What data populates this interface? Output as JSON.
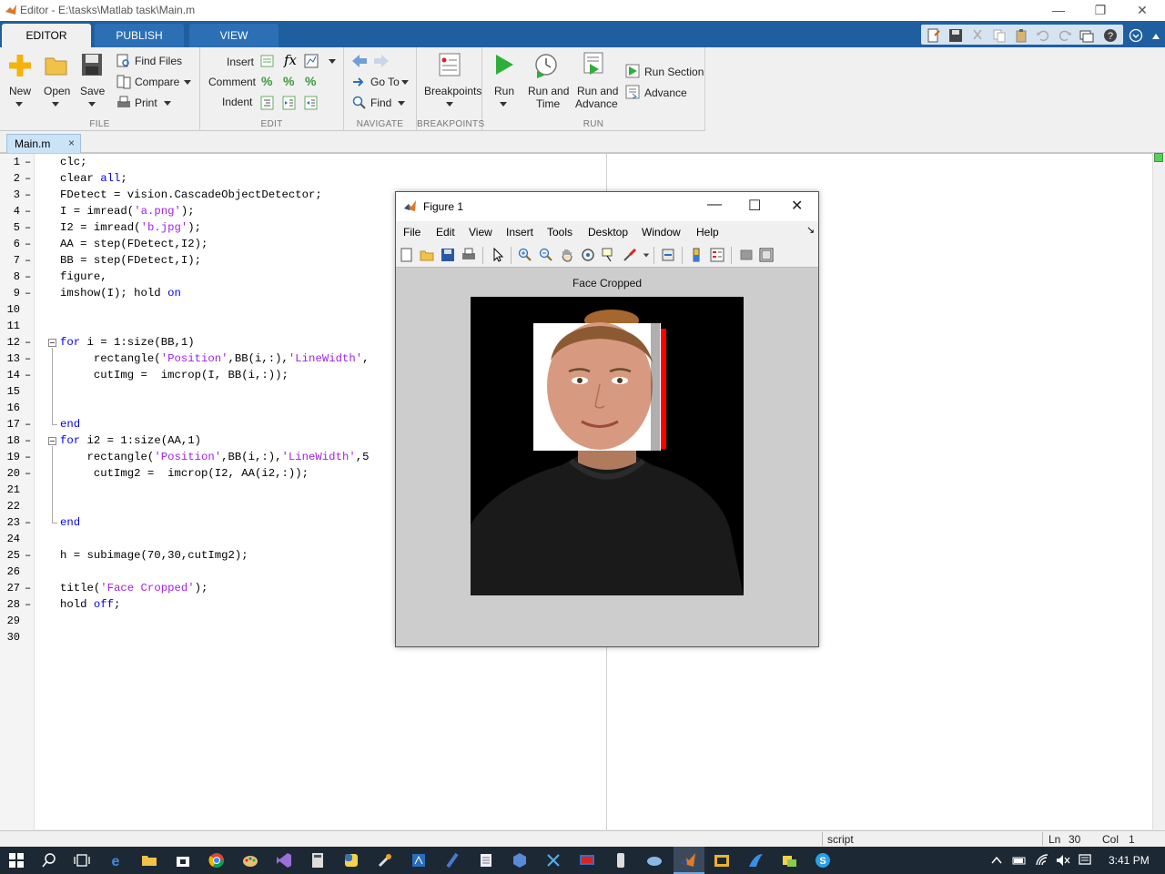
{
  "window": {
    "title": "Editor - E:\\tasks\\Matlab task\\Main.m",
    "minimize_glyph": "—",
    "restore_glyph": "❐",
    "close_glyph": "✕"
  },
  "ribbon_tabs": [
    {
      "label": "EDITOR",
      "active": true
    },
    {
      "label": "PUBLISH",
      "active": false
    },
    {
      "label": "VIEW",
      "active": false
    }
  ],
  "ribbon": {
    "file": {
      "section_label": "FILE",
      "new_label": "New",
      "open_label": "Open",
      "save_label": "Save",
      "find_files_label": "Find Files",
      "compare_label": "Compare",
      "print_label": "Print"
    },
    "edit": {
      "section_label": "EDIT",
      "insert_label": "Insert",
      "comment_label": "Comment",
      "indent_label": "Indent"
    },
    "navigate": {
      "section_label": "NAVIGATE",
      "goto_label": "Go To",
      "find_label": "Find"
    },
    "breakpoints": {
      "section_label": "BREAKPOINTS",
      "breakpoints_label": "Breakpoints"
    },
    "run": {
      "section_label": "RUN",
      "run_label": "Run",
      "run_time_line1": "Run and",
      "run_time_line2": "Time",
      "run_advance_line1": "Run and",
      "run_advance_line2": "Advance",
      "run_section_label": "Run Section",
      "advance_label": "Advance"
    }
  },
  "doc_tab": {
    "label": "Main.m",
    "close_glyph": "×"
  },
  "editor": {
    "lines": [
      {
        "n": "1",
        "dash": true,
        "parts": [
          [
            "t",
            "clc;"
          ]
        ]
      },
      {
        "n": "2",
        "dash": true,
        "parts": [
          [
            "t",
            "clear "
          ],
          [
            "k",
            "all"
          ],
          [
            "t",
            ";"
          ]
        ]
      },
      {
        "n": "3",
        "dash": true,
        "parts": [
          [
            "t",
            "FDetect = vision.CascadeObjectDetector;"
          ]
        ]
      },
      {
        "n": "4",
        "dash": true,
        "parts": [
          [
            "t",
            "I = imread("
          ],
          [
            "s",
            "'a.png'"
          ],
          [
            "t",
            ");"
          ]
        ]
      },
      {
        "n": "5",
        "dash": true,
        "parts": [
          [
            "t",
            "I2 = imread("
          ],
          [
            "s",
            "'b.jpg'"
          ],
          [
            "t",
            ");"
          ]
        ]
      },
      {
        "n": "6",
        "dash": true,
        "parts": [
          [
            "t",
            "AA = step(FDetect,I2);"
          ]
        ]
      },
      {
        "n": "7",
        "dash": true,
        "parts": [
          [
            "t",
            "BB = step(FDetect,I);"
          ]
        ]
      },
      {
        "n": "8",
        "dash": true,
        "parts": [
          [
            "t",
            "figure,"
          ]
        ]
      },
      {
        "n": "9",
        "dash": true,
        "parts": [
          [
            "t",
            "imshow(I); hold "
          ],
          [
            "k",
            "on"
          ]
        ]
      },
      {
        "n": "10",
        "dash": false,
        "parts": []
      },
      {
        "n": "11",
        "dash": false,
        "parts": []
      },
      {
        "n": "12",
        "dash": true,
        "parts": [
          [
            "k",
            "for"
          ],
          [
            "t",
            " i = 1:size(BB,1)"
          ]
        ]
      },
      {
        "n": "13",
        "dash": true,
        "parts": [
          [
            "t",
            "     rectangle("
          ],
          [
            "s",
            "'Position'"
          ],
          [
            "t",
            ",BB(i,:),"
          ],
          [
            "s",
            "'LineWidth'"
          ],
          [
            "t",
            ","
          ]
        ]
      },
      {
        "n": "14",
        "dash": true,
        "parts": [
          [
            "t",
            "     cutImg =  imcrop(I, BB(i,:));"
          ]
        ]
      },
      {
        "n": "15",
        "dash": false,
        "parts": []
      },
      {
        "n": "16",
        "dash": false,
        "parts": []
      },
      {
        "n": "17",
        "dash": true,
        "parts": [
          [
            "k",
            "end"
          ]
        ]
      },
      {
        "n": "18",
        "dash": true,
        "parts": [
          [
            "k",
            "for"
          ],
          [
            "t",
            " i2 = 1:size(AA,1)"
          ]
        ]
      },
      {
        "n": "19",
        "dash": true,
        "parts": [
          [
            "t",
            "    rectangle("
          ],
          [
            "s",
            "'Position'"
          ],
          [
            "t",
            ",BB(i,:),"
          ],
          [
            "s",
            "'LineWidth'"
          ],
          [
            "t",
            ",5"
          ]
        ]
      },
      {
        "n": "20",
        "dash": true,
        "parts": [
          [
            "t",
            "     cutImg2 =  imcrop(I2, AA(i2,:));"
          ]
        ]
      },
      {
        "n": "21",
        "dash": false,
        "parts": []
      },
      {
        "n": "22",
        "dash": false,
        "parts": []
      },
      {
        "n": "23",
        "dash": true,
        "parts": [
          [
            "k",
            "end"
          ]
        ]
      },
      {
        "n": "24",
        "dash": false,
        "parts": []
      },
      {
        "n": "25",
        "dash": true,
        "parts": [
          [
            "t",
            "h = subimage(70,30,cutImg2);"
          ]
        ]
      },
      {
        "n": "26",
        "dash": false,
        "parts": []
      },
      {
        "n": "27",
        "dash": true,
        "parts": [
          [
            "t",
            "title("
          ],
          [
            "s",
            "'Face Cropped'"
          ],
          [
            "t",
            ");"
          ]
        ]
      },
      {
        "n": "28",
        "dash": true,
        "parts": [
          [
            "t",
            "hold "
          ],
          [
            "k",
            "off"
          ],
          [
            "t",
            ";"
          ]
        ]
      },
      {
        "n": "29",
        "dash": false,
        "parts": []
      },
      {
        "n": "30",
        "dash": false,
        "parts": []
      }
    ]
  },
  "status": {
    "mode": "script",
    "ln_label": "Ln",
    "ln_value": "30",
    "col_label": "Col",
    "col_value": "1"
  },
  "figure": {
    "title": "Figure 1",
    "menu": [
      "File",
      "Edit",
      "View",
      "Insert",
      "Tools",
      "Desktop",
      "Window",
      "Help"
    ],
    "axes_title": "Face Cropped",
    "minimize_glyph": "—",
    "maximize_glyph": "☐",
    "close_glyph": "✕",
    "dock_glyph": "↘"
  },
  "taskbar": {
    "clock": "3:41 PM"
  },
  "colors": {
    "ribbon_tab_bar": "#1f5f9f",
    "keyword": "#0000ff",
    "string": "#a020f0",
    "taskbar": "#1c2834"
  }
}
